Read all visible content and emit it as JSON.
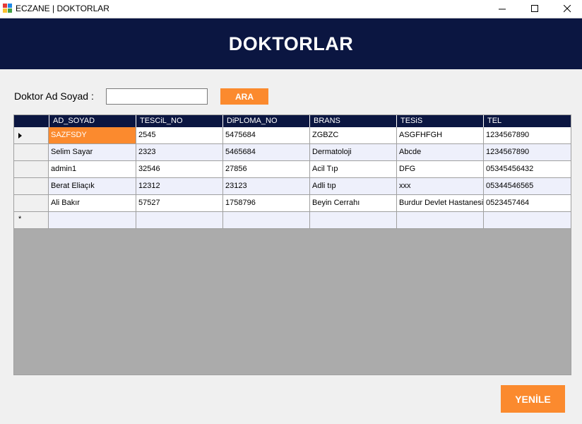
{
  "window": {
    "title": "ECZANE | DOKTORLAR",
    "minimize_icon": "minimize-icon",
    "maximize_icon": "maximize-icon",
    "close_icon": "close-icon"
  },
  "header": {
    "title": "DOKTORLAR"
  },
  "search": {
    "label": "Doktor Ad Soyad :",
    "value": "",
    "placeholder": "",
    "button_label": "ARA"
  },
  "grid": {
    "columns": [
      "AD_SOYAD",
      "TESCiL_NO",
      "DiPLOMA_NO",
      "BRANS",
      "TESiS",
      "TEL"
    ],
    "rows": [
      [
        "SAZFSDY",
        "2545",
        "5475684",
        "ZGBZC",
        "ASGFHFGH",
        "1234567890"
      ],
      [
        "Selim Sayar",
        "2323",
        "5465684",
        "Dermatoloji",
        "Abcde",
        "1234567890"
      ],
      [
        "admin1",
        "32546",
        "27856",
        "Acil Tıp",
        "DFG",
        "05345456432"
      ],
      [
        "Berat Eliaçık",
        "12312",
        "23123",
        "Adli tıp",
        "xxx",
        "05344546565"
      ],
      [
        "Ali Bakır",
        "57527",
        "1758796",
        "Beyin Cerrahı",
        "Burdur Devlet Hastanesi",
        "0523457464"
      ]
    ],
    "new_row_marker": "*"
  },
  "refresh_button": {
    "label": "YENİLE"
  },
  "colors": {
    "header_bg": "#0b1641",
    "accent": "#fb8a2e",
    "grid_bg": "#ababab",
    "alt_row": "#eef0fb"
  }
}
